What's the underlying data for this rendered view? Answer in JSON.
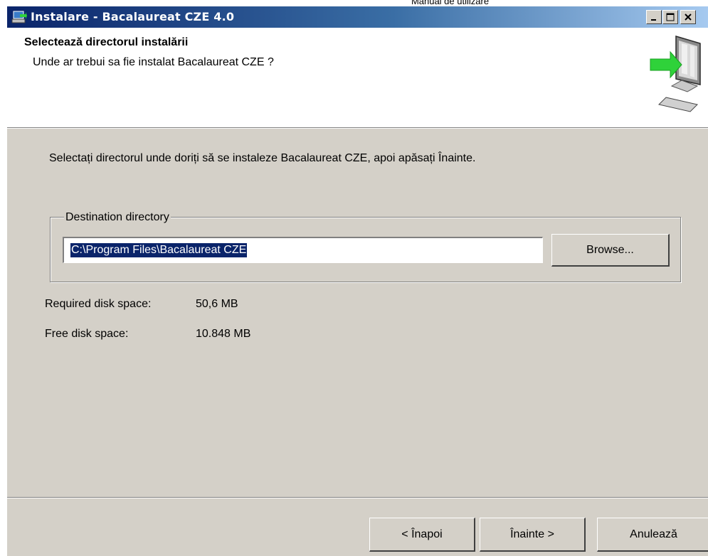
{
  "document": {
    "header": "Manual de utilizare"
  },
  "window": {
    "title": "Instalare - Bacalaureat CZE 4.0",
    "controls": {
      "minimize": "minimize-icon",
      "maximize": "maximize-icon",
      "close": "close-icon"
    }
  },
  "header": {
    "title": "Selectează directorul instalării",
    "subtitle": "Unde ar trebui sa fie instalat Bacalaureat CZE ?",
    "image": "computer-arrow-icon"
  },
  "main": {
    "instruction": "Selectați directorul unde doriți să se instaleze Bacalaureat CZE, apoi apăsați Înainte.",
    "destination": {
      "label": "Destination directory",
      "path": "C:\\Program Files\\Bacalaureat CZE",
      "browse_label": "Browse..."
    },
    "disk": {
      "required_label": "Required disk space:",
      "required_value": "50,6 MB",
      "free_label": "Free disk space:",
      "free_value": "10.848 MB"
    }
  },
  "footer": {
    "back_label": "< Înapoi",
    "next_label": "Înainte >",
    "cancel_label": "Anulează"
  },
  "colors": {
    "titlebar_start": "#0a246a",
    "titlebar_end": "#a6caf0",
    "window_bg": "#d4d0c8",
    "selection": "#0a246a",
    "arrow": "#2fd23a"
  }
}
